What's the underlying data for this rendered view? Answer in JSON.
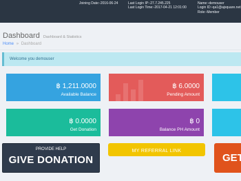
{
  "header": {
    "joining_date": "Joining Date:-2016-06-24",
    "last_login_ip": "Last Login IP:-27.7.245.225",
    "last_login_time": "Last Login Time:-2017-04-21 12:01:00",
    "name": "Name:-demouser",
    "login_id": "Login ID:-qa1@ajsquare.net",
    "role": "Role:-Member"
  },
  "page": {
    "title": "Dashboard",
    "subtitle": "Dashboard & Statistics",
    "breadcrumb": [
      "Home",
      "Dashboard"
    ],
    "breadcrumb_separator": "»"
  },
  "notice": "Welcome you demouser",
  "stats": [
    {
      "value": "฿ 1,211.0000",
      "label": "Available Balance"
    },
    {
      "value": "฿ 6.0000",
      "label": "Pending Amount"
    },
    {
      "value": "฿ 0.0000",
      "label": "Get Donation"
    },
    {
      "value": "฿ 0",
      "label": "Balance PH Amount"
    }
  ],
  "actions": {
    "give_small": "PROVIDE HELP",
    "give_big": "GIVE DONATION",
    "referral": "MY REFERRAL LINK",
    "get_big": "GET"
  },
  "colors": {
    "header": "#2b3643",
    "available_balance": "#35a3e0",
    "pending_amount": "#e35b5a",
    "get_donation": "#1bbc9b",
    "balance_ph": "#8e44ad",
    "referral": "#f2c500",
    "get_help": "#e0531c"
  }
}
